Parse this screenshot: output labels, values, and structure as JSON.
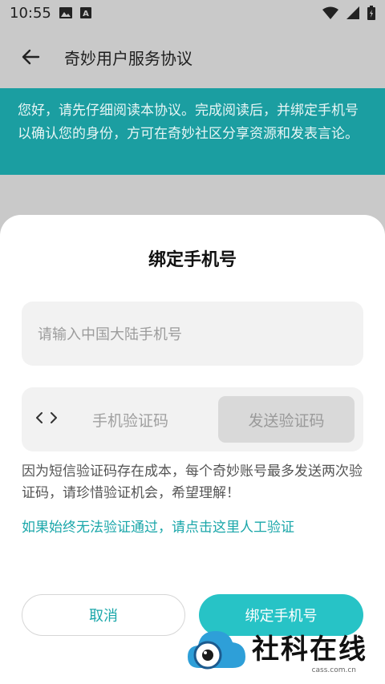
{
  "status_bar": {
    "time": "10:55",
    "icons": [
      "image-icon",
      "font-a-icon",
      "wifi-icon",
      "signal-icon",
      "battery-icon"
    ]
  },
  "app_bar": {
    "title": "奇妙用户服务协议",
    "back_icon": "arrow-left-icon"
  },
  "notice": {
    "text": "您好，请先仔细阅读本协议。完成阅读后，并绑定手机号以确认您的身份，方可在奇妙社区分享资源和发表言论。"
  },
  "dialog": {
    "title": "绑定手机号",
    "phone_placeholder": "请输入中国大陆手机号",
    "code_icon": "code-brackets-icon",
    "code_placeholder": "手机验证码",
    "send_code_label": "发送验证码",
    "hint": "因为短信验证码存在成本，每个奇妙账号最多发送两次验证码，请珍惜验证机会，希望理解！",
    "manual_link": "如果始终无法验证通过，请点击这里人工验证",
    "cancel_label": "取消",
    "confirm_label": "绑定手机号"
  },
  "watermark": {
    "title": "社科在线",
    "domain": "cass.com.cn"
  },
  "colors": {
    "accent": "#1b9ea1",
    "button": "#27c3c6",
    "link": "#1ba7aa"
  }
}
